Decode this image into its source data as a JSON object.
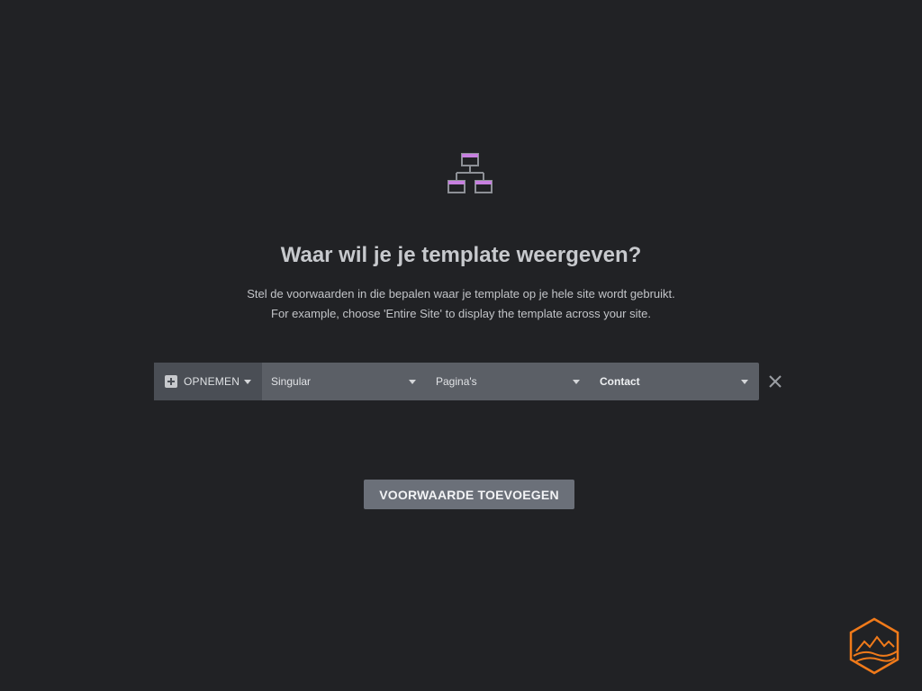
{
  "header": {
    "title": "Waar wil je je template weergeven?",
    "description_line1": "Stel de voorwaarden in die bepalen waar je template op je hele site wordt gebruikt.",
    "description_line2": "For example, choose 'Entire Site' to display the template across your site."
  },
  "condition": {
    "type_label": "OPNEMEN",
    "select_1": "Singular",
    "select_2": "Pagina's",
    "select_3": "Contact"
  },
  "actions": {
    "add_condition_label": "VOORWAARDE TOEVOEGEN"
  },
  "icons": {
    "hero": "sitemap-icon",
    "type_add": "plus-square-icon",
    "dropdown": "caret-down-icon",
    "remove": "close-icon",
    "brand": "hexagon-mountain-logo"
  },
  "colors": {
    "background": "#212225",
    "accent": "#c780e0",
    "logo": "#f07a1a",
    "button": "#6b7079",
    "row": "#5b5f66"
  }
}
